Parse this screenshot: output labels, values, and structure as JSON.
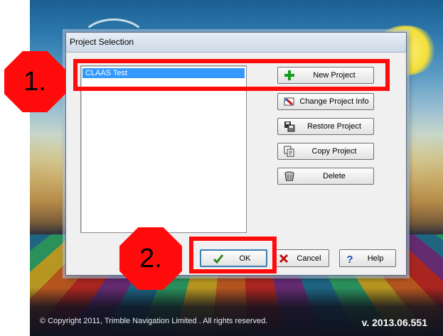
{
  "app": {
    "copyright": "© Copyright 2011, Trimble Navigation Limited . All rights reserved.",
    "version": "v. 2013.06.551"
  },
  "dialog": {
    "title": "Project Selection",
    "projects": [
      "CLAAS Test"
    ],
    "selected_index": 0,
    "buttons": {
      "new_project": "New Project",
      "change_project_info": "Change Project Info",
      "restore_project": "Restore Project",
      "copy_project": "Copy Project",
      "delete": "Delete",
      "ok": "OK",
      "cancel": "Cancel",
      "help": "Help"
    },
    "icons": {
      "new_project": "plus-icon",
      "change_project_info": "edit-info-icon",
      "restore_project": "restore-disk-icon",
      "copy_project": "copy-icon",
      "delete": "trash-icon",
      "ok": "checkmark-icon",
      "cancel": "x-icon",
      "help": "question-icon"
    }
  },
  "annotations": {
    "step1": "1.",
    "step2": "2.",
    "color": "#ff0b0b"
  }
}
